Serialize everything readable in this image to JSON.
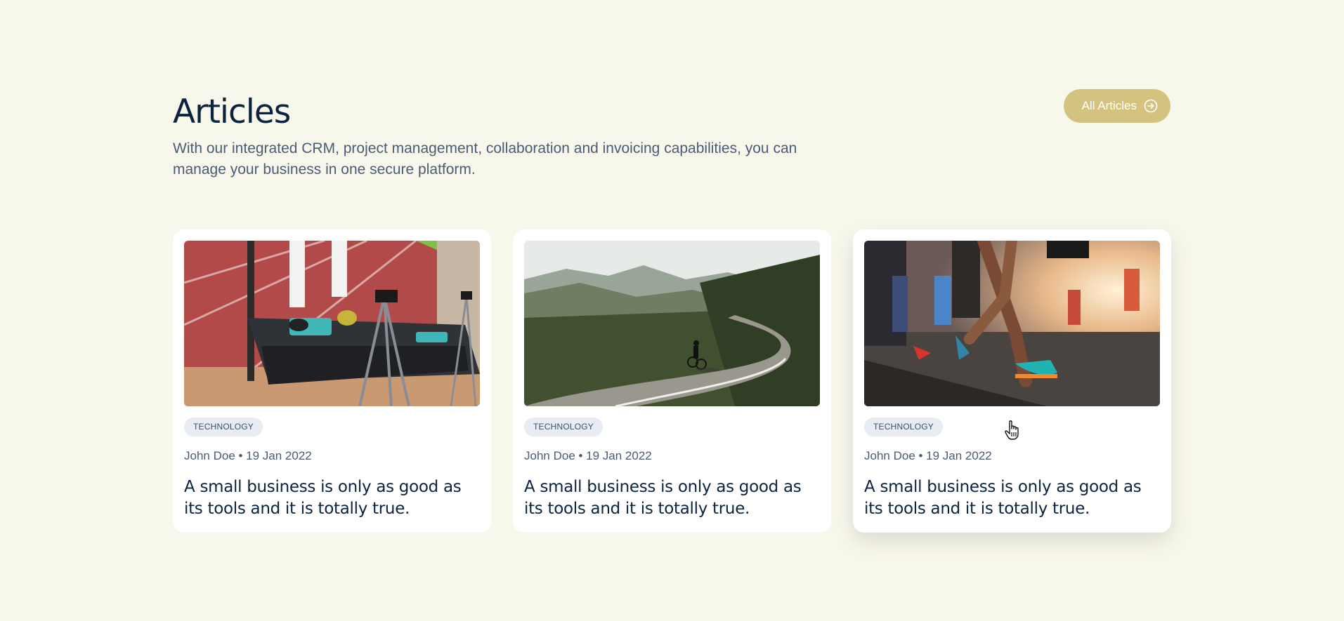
{
  "section": {
    "title": "Articles",
    "subtitle": "With our integrated CRM, project management, collaboration and invoicing capabilities, you can manage your business in one secure platform.",
    "all_button": {
      "label": "All Articles",
      "icon": "arrow-right-circle-icon"
    }
  },
  "colors": {
    "background": "#f8f7ec",
    "accent": "#d4c27f",
    "heading": "#0c2340",
    "badge_bg": "#e8edf3"
  },
  "articles": [
    {
      "image": "treadmill-running-track-photo",
      "tag": "TECHNOLOGY",
      "meta": "John Doe • 19 Jan 2022",
      "title": "A small business is only as good as its tools and it is totally true."
    },
    {
      "image": "cyclist-mountain-road-photo",
      "tag": "TECHNOLOGY",
      "meta": "John Doe • 19 Jan 2022",
      "title": "A small business is only as good as its tools and it is totally true."
    },
    {
      "image": "marathon-runners-photo",
      "tag": "TECHNOLOGY",
      "meta": "John Doe • 19 Jan 2022",
      "title": "A small business is only as good as its tools and it is totally true."
    }
  ]
}
